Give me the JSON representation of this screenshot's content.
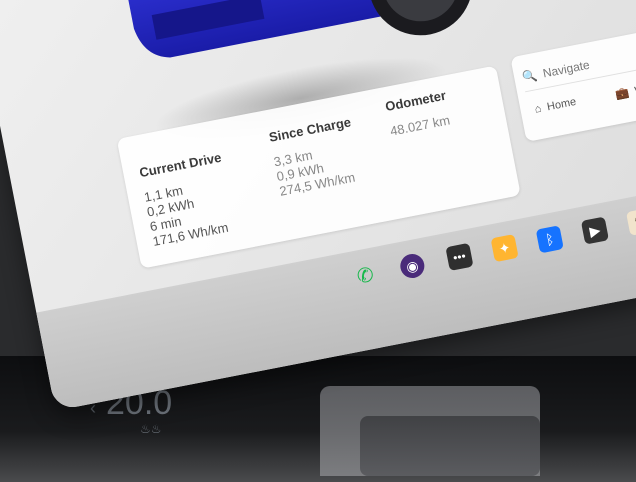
{
  "trip": {
    "current_drive": {
      "title": "Current Drive",
      "distance": "1,1 km",
      "energy": "0,2 kWh",
      "duration": "6 min",
      "efficiency": "171,6 Wh/km"
    },
    "since_charge": {
      "title": "Since Charge",
      "distance": "3,3 km",
      "energy": "0,9 kWh",
      "efficiency": "274,5 Wh/km"
    },
    "odometer": {
      "title": "Odometer",
      "value": "48.027 km"
    }
  },
  "navigation": {
    "search_placeholder": "Navigate",
    "home_label": "Home",
    "work_label": "W"
  },
  "dock": {
    "icons": [
      "phone-icon",
      "camera-icon",
      "more-icon",
      "apps-icon",
      "bluetooth-icon",
      "media-icon",
      "notes-icon"
    ]
  },
  "climate": {
    "temperature": "20.0",
    "chevron": "‹"
  },
  "colors": {
    "car_blue": "#2b2fd6",
    "phone_green": "#17b84b",
    "bluetooth_blue": "#1673ff"
  }
}
